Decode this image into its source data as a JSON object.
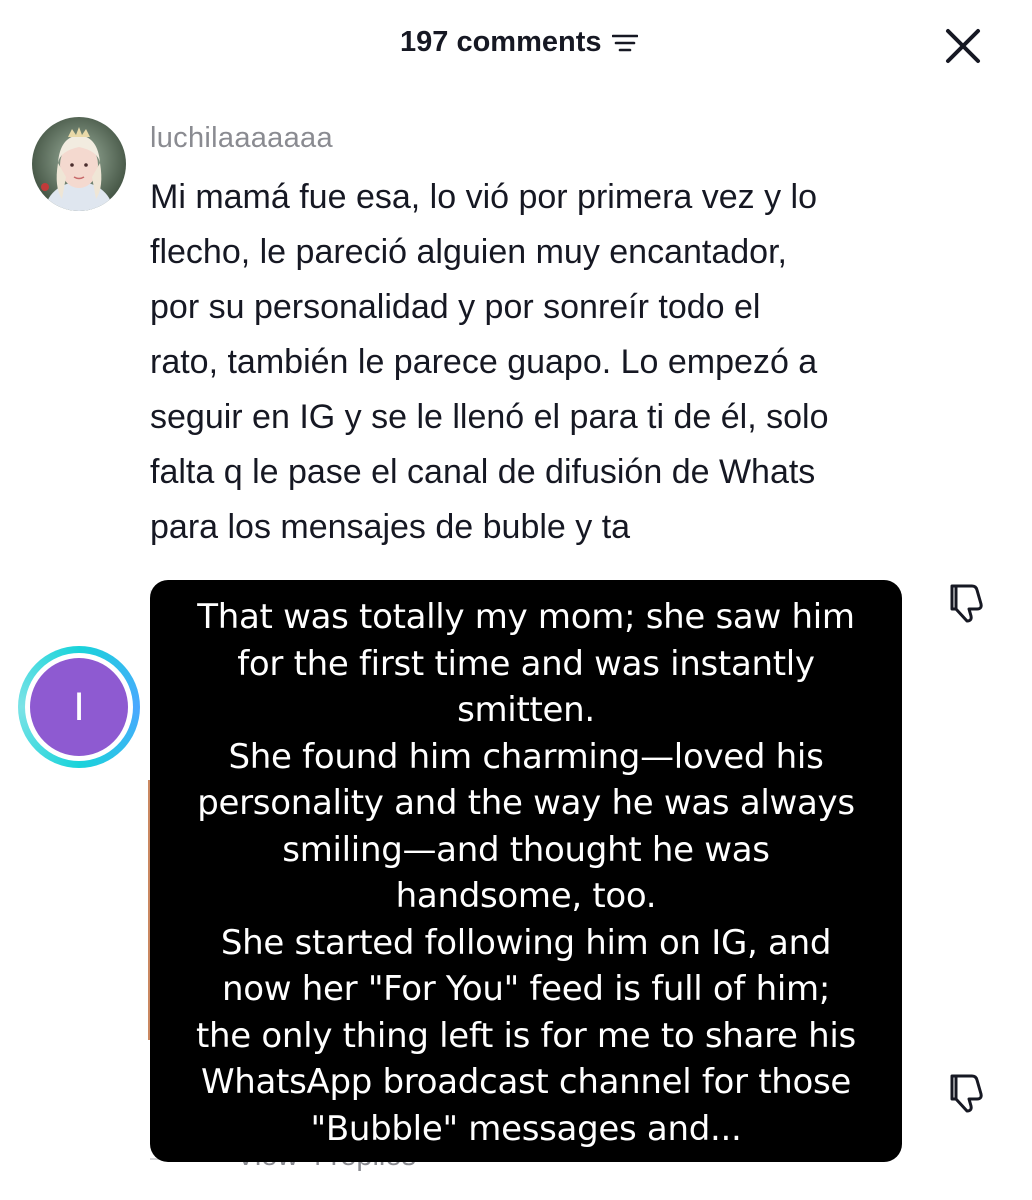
{
  "header": {
    "title": "197 comments",
    "sort_icon": "sort-lines-icon",
    "close_icon": "close-x-icon"
  },
  "comment": {
    "username": "luchilaaaaaaa",
    "avatar": "profile-photo",
    "text": "Mi mamá fue esa, lo vió por primera vez y lo\nflecho, le pareció alguien muy encantador,\npor su personalidad y por sonreír todo el\nrato, también le parece guapo. Lo empezó a\nseguir en IG y se le llenó el para ti de él, solo\nfalta q le pase el canal de difusión de Whats\npara los mensajes de buble y ta"
  },
  "next_comment": {
    "avatar_initial": "I",
    "view_replies": "View 4 replies"
  },
  "translation_overlay": {
    "lines": [
      "That was totally my mom; she saw him",
      "for the first time and was instantly",
      "smitten.",
      "She found him charming—loved his",
      "personality and the way he was always",
      "smiling—and thought he was",
      "handsome, too.",
      "She started following him on IG, and",
      "now her \"For You\" feed is full of him;",
      "the only thing left is for me to share his",
      "WhatsApp broadcast channel for those",
      "\"Bubble\" messages and..."
    ]
  },
  "colors": {
    "text_primary": "#161823",
    "text_secondary": "#8a8b91",
    "overlay_bg": "#000000",
    "avatar_purple": "#8e5ad1",
    "story_ring": "#19d3da"
  }
}
